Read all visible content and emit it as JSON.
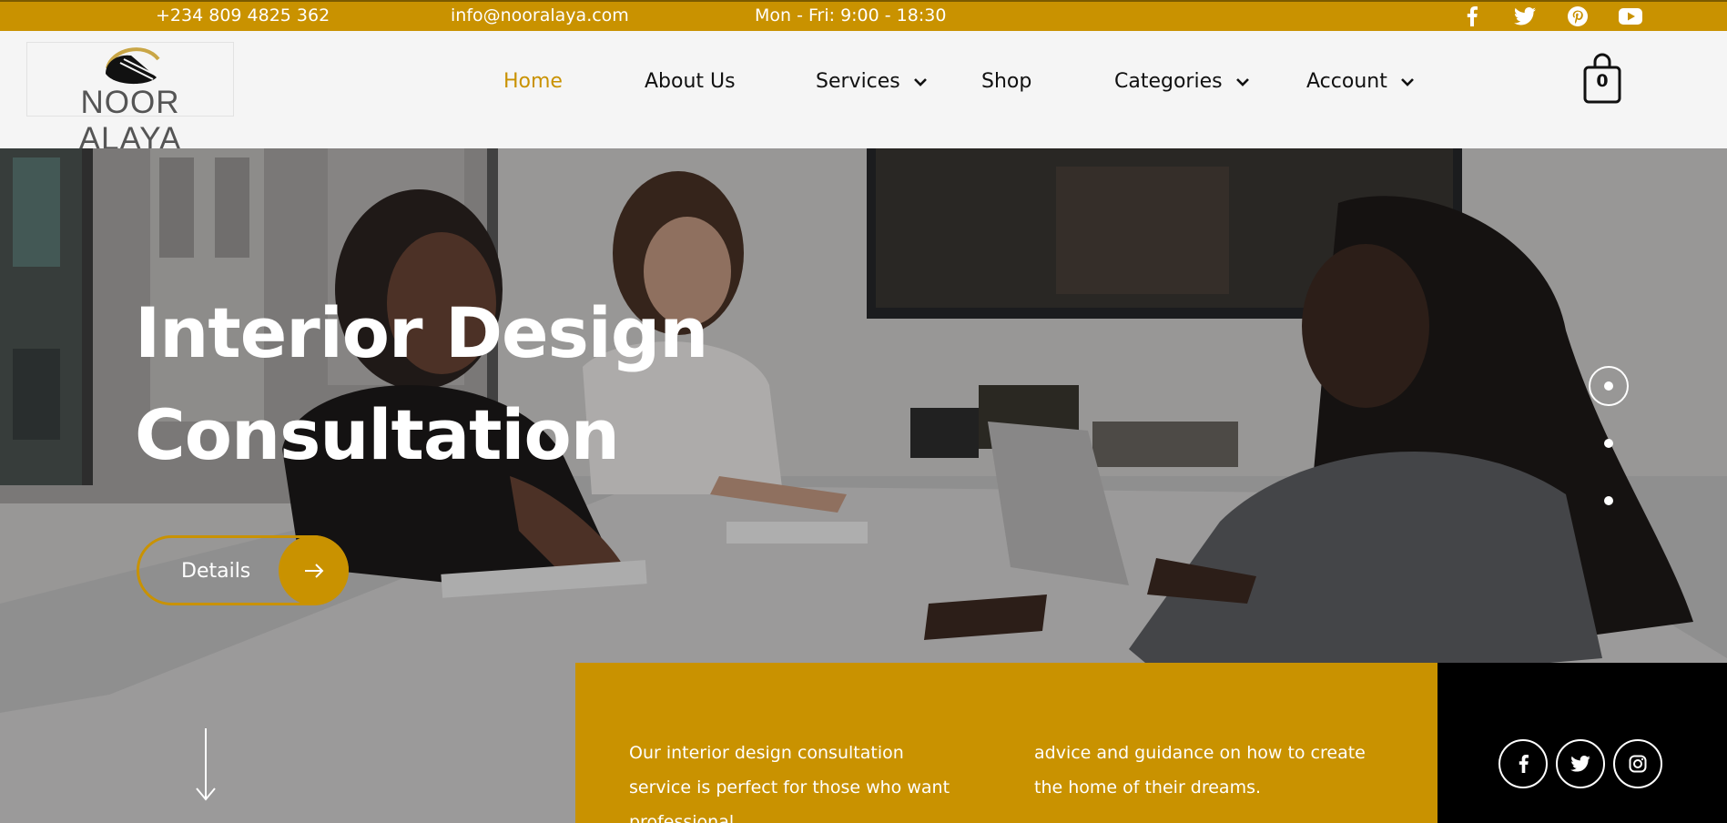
{
  "topbar": {
    "phone": "+234 809 4825 362",
    "email": "info@nooralaya.com",
    "hours": "Mon - Fri: 9:00 - 18:30",
    "social_icons": [
      "facebook-icon",
      "twitter-icon",
      "pinterest-icon",
      "youtube-icon"
    ]
  },
  "header": {
    "logo_text": "NOOR ALAYA",
    "nav": [
      {
        "label": "Home",
        "active": true
      },
      {
        "label": "About Us"
      },
      {
        "label": "Services",
        "dropdown": true
      },
      {
        "label": "Shop"
      },
      {
        "label": "Categories",
        "dropdown": true
      },
      {
        "label": "Account",
        "dropdown": true
      }
    ],
    "cart_count": "0"
  },
  "hero": {
    "title_line1": "Interior Design",
    "title_line2": "Consultation",
    "details_label": "Details",
    "slides": 3,
    "active_slide": 1,
    "description_col1": "Our interior design consultation service is perfect for those who want professional",
    "description_col2": "advice and guidance on how to create the home of their dreams.",
    "social_icons": [
      "facebook-icon",
      "twitter-icon",
      "instagram-icon"
    ]
  },
  "colors": {
    "accent": "#c99200",
    "black": "#000000",
    "header_bg": "#f5f5f5"
  }
}
